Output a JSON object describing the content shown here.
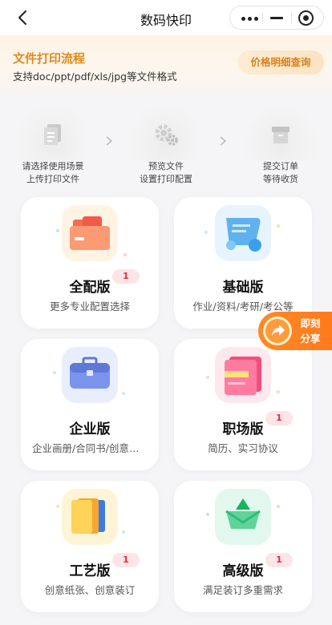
{
  "nav": {
    "title": "数码快印"
  },
  "banner": {
    "title": "文件打印流程",
    "subtitle": "支持doc/ppt/pdf/xls/jpg等文件格式",
    "price_button": "价格明细查询"
  },
  "steps": [
    {
      "line1": "请选择使用场景",
      "line2": "上传打印文件",
      "icon": "document-icon"
    },
    {
      "line1": "预览文件",
      "line2": "设置打印配置",
      "icon": "gear-icon"
    },
    {
      "line1": "提交订单",
      "line2": "等待收货",
      "icon": "box-icon"
    }
  ],
  "cards": [
    {
      "name": "全配版",
      "desc": "更多专业配置选择",
      "badge": "1",
      "icon": "folder-icon"
    },
    {
      "name": "基础版",
      "desc": "作业/资料/考研/考公等",
      "badge": "",
      "icon": "scroll-icon"
    },
    {
      "name": "企业版",
      "desc": "企业画册/合同书/创意设计",
      "badge": "",
      "icon": "briefcase-icon"
    },
    {
      "name": "职场版",
      "desc": "简历、实习协议",
      "badge": "1",
      "icon": "notebook-icon"
    },
    {
      "name": "工艺版",
      "desc": "创意纸张、创意装订",
      "badge": "1",
      "icon": "paper-stack-icon"
    },
    {
      "name": "高级版",
      "desc": "满足装订多重需求",
      "badge": "1",
      "icon": "crown-icon"
    }
  ],
  "share": {
    "line1": "即刻",
    "line2": "分享"
  },
  "colors": {
    "accent": "#e18a1a",
    "badge": "#e22c3c",
    "share": "#ff8a2a"
  }
}
